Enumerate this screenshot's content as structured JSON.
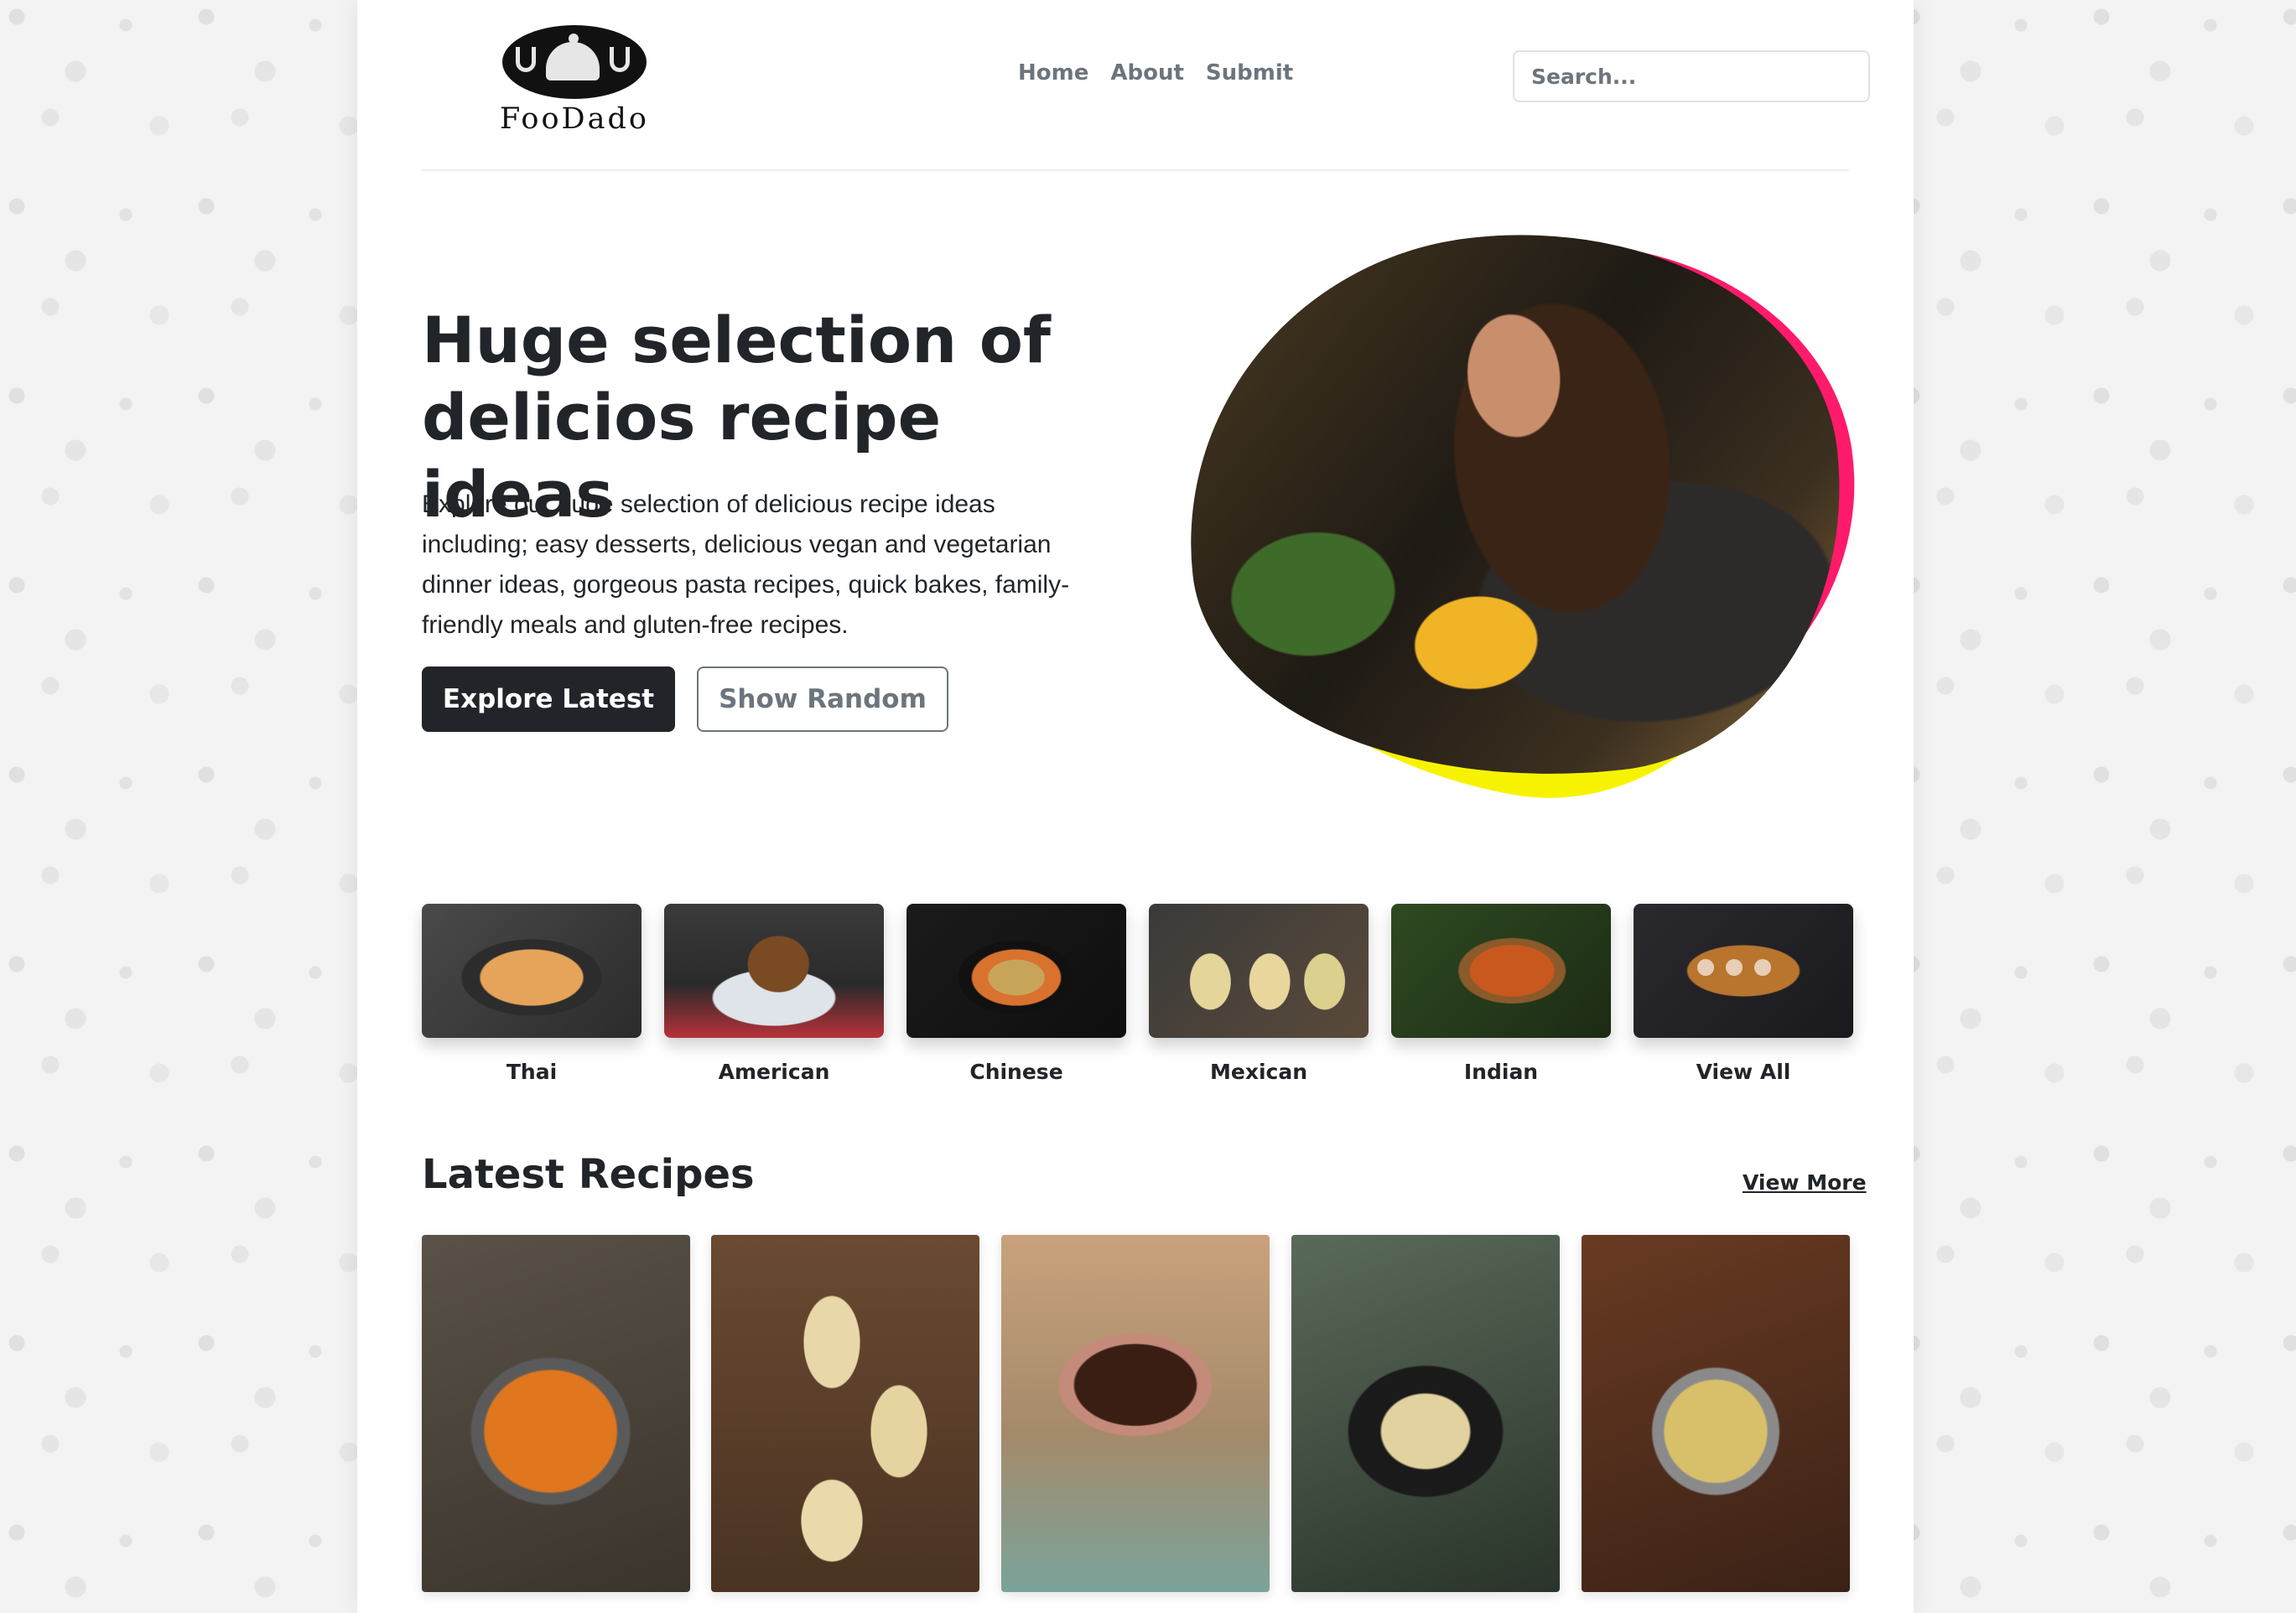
{
  "header": {
    "logo_text": "FooDado",
    "nav": [
      "Home",
      "About",
      "Submit"
    ],
    "search_placeholder": "Search..."
  },
  "hero": {
    "title_line1": "Huge selection of",
    "title_line2": "delicios recipe ideas",
    "description": "Explore our huge selection of delicious recipe ideas including; easy desserts, delicious vegan and vegetarian dinner ideas, gorgeous pasta recipes, quick bakes, family-friendly meals and gluten-free recipes.",
    "primary_button": "Explore Latest",
    "secondary_button": "Show Random"
  },
  "categories": [
    "Thai",
    "American",
    "Chinese",
    "Mexican",
    "Indian",
    "View All"
  ],
  "latest": {
    "title": "Latest Recipes",
    "view_more": "View More"
  },
  "colors": {
    "dark": "#212529",
    "muted": "#6c757d",
    "blob_pink": "#ff1a6b",
    "blob_yellow": "#f7f300"
  }
}
